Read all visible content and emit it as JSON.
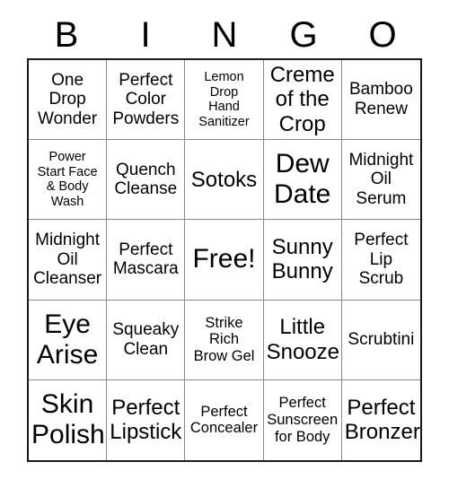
{
  "card": {
    "header_letters": [
      "B",
      "I",
      "N",
      "G",
      "O"
    ],
    "free_space_label": "Free!",
    "cells": [
      {
        "text": "One\nDrop\nWonder",
        "size": "md"
      },
      {
        "text": "Perfect\nColor\nPowders",
        "size": "md"
      },
      {
        "text": "Lemon\nDrop\nHand\nSanitizer",
        "size": "xs"
      },
      {
        "text": "Creme\nof the\nCrop",
        "size": "lg"
      },
      {
        "text": "Bamboo\nRenew",
        "size": "md"
      },
      {
        "text": "Power\nStart Face\n& Body\nWash",
        "size": "xs"
      },
      {
        "text": "Quench\nCleanse",
        "size": "md"
      },
      {
        "text": "Sotoks",
        "size": "lg"
      },
      {
        "text": "Dew\nDate",
        "size": "xl"
      },
      {
        "text": "Midnight\nOil\nSerum",
        "size": "md"
      },
      {
        "text": "Midnight\nOil\nCleanser",
        "size": "md"
      },
      {
        "text": "Perfect\nMascara",
        "size": "md"
      },
      {
        "text": "Free!",
        "size": "xl"
      },
      {
        "text": "Sunny\nBunny",
        "size": "lg"
      },
      {
        "text": "Perfect\nLip\nScrub",
        "size": "md"
      },
      {
        "text": "Eye\nArise",
        "size": "xl"
      },
      {
        "text": "Squeaky\nClean",
        "size": "md"
      },
      {
        "text": "Strike\nRich\nBrow Gel",
        "size": "sm"
      },
      {
        "text": "Little\nSnooze",
        "size": "lg"
      },
      {
        "text": "Scrubtini",
        "size": "md"
      },
      {
        "text": "Skin\nPolish",
        "size": "xl"
      },
      {
        "text": "Perfect\nLipstick",
        "size": "lg"
      },
      {
        "text": "Perfect\nConcealer",
        "size": "sm"
      },
      {
        "text": "Perfect\nSunscreen\nfor Body",
        "size": "sm"
      },
      {
        "text": "Perfect\nBronzer",
        "size": "lg"
      }
    ]
  }
}
